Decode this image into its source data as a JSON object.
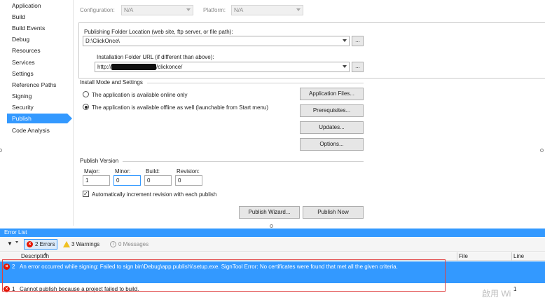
{
  "nav": {
    "items": [
      {
        "label": "Application"
      },
      {
        "label": "Build"
      },
      {
        "label": "Build Events"
      },
      {
        "label": "Debug"
      },
      {
        "label": "Resources"
      },
      {
        "label": "Services"
      },
      {
        "label": "Settings"
      },
      {
        "label": "Reference Paths"
      },
      {
        "label": "Signing"
      },
      {
        "label": "Security"
      },
      {
        "label": "Publish",
        "selected": true
      },
      {
        "label": "Code Analysis"
      }
    ]
  },
  "config": {
    "configuration_label": "Configuration:",
    "configuration_value": "N/A",
    "platform_label": "Platform:",
    "platform_value": "N/A"
  },
  "publish": {
    "folder_label": "Publishing Folder Location (web site, ftp server, or file path):",
    "folder_value": "D:\\ClickOnce\\",
    "folder_browse": "...",
    "install_url_label": "Installation Folder URL (if different than above):",
    "install_url_prefix": "http://",
    "install_url_suffix": "/clickonce/",
    "install_url_browse": "..."
  },
  "install_mode": {
    "heading": "Install Mode and Settings",
    "online_label": "The application is available online only",
    "offline_label": "The application is available offline as well (launchable from Start menu)",
    "selected": "offline",
    "buttons": {
      "application_files": "Application Files...",
      "prerequisites": "Prerequisites...",
      "updates": "Updates...",
      "options": "Options..."
    }
  },
  "version": {
    "heading": "Publish Version",
    "major_label": "Major:",
    "minor_label": "Minor:",
    "build_label": "Build:",
    "revision_label": "Revision:",
    "major": "1",
    "minor": "0",
    "build": "0",
    "revision": "0",
    "auto_increment_label": "Automatically increment revision with each publish",
    "auto_increment_checked": true
  },
  "actions": {
    "publish_wizard": "Publish Wizard...",
    "publish_now": "Publish Now"
  },
  "error_list": {
    "title": "Error List",
    "filter_glyph": "▼",
    "errors_label": "2 Errors",
    "warnings_label": "3 Warnings",
    "messages_label": "0 Messages",
    "columns": {
      "description": "Description",
      "file": "File",
      "line": "Line"
    },
    "rows": [
      {
        "num": "2",
        "description": "An error occurred while signing: Failed to sign bin\\Debug\\app.publish\\\\setup.exe. SignTool Error: No certificates were found that met all the given criteria.",
        "file": "",
        "line": "",
        "selected": true
      },
      {
        "num": "1",
        "description": "Cannot publish because a project failed to build.",
        "file": "",
        "line": "1",
        "selected": false
      }
    ]
  },
  "watermark": "啟用 Wi",
  "colors": {
    "accent": "#3399ff",
    "error": "#e51400",
    "highlight_border": "#e04040"
  }
}
